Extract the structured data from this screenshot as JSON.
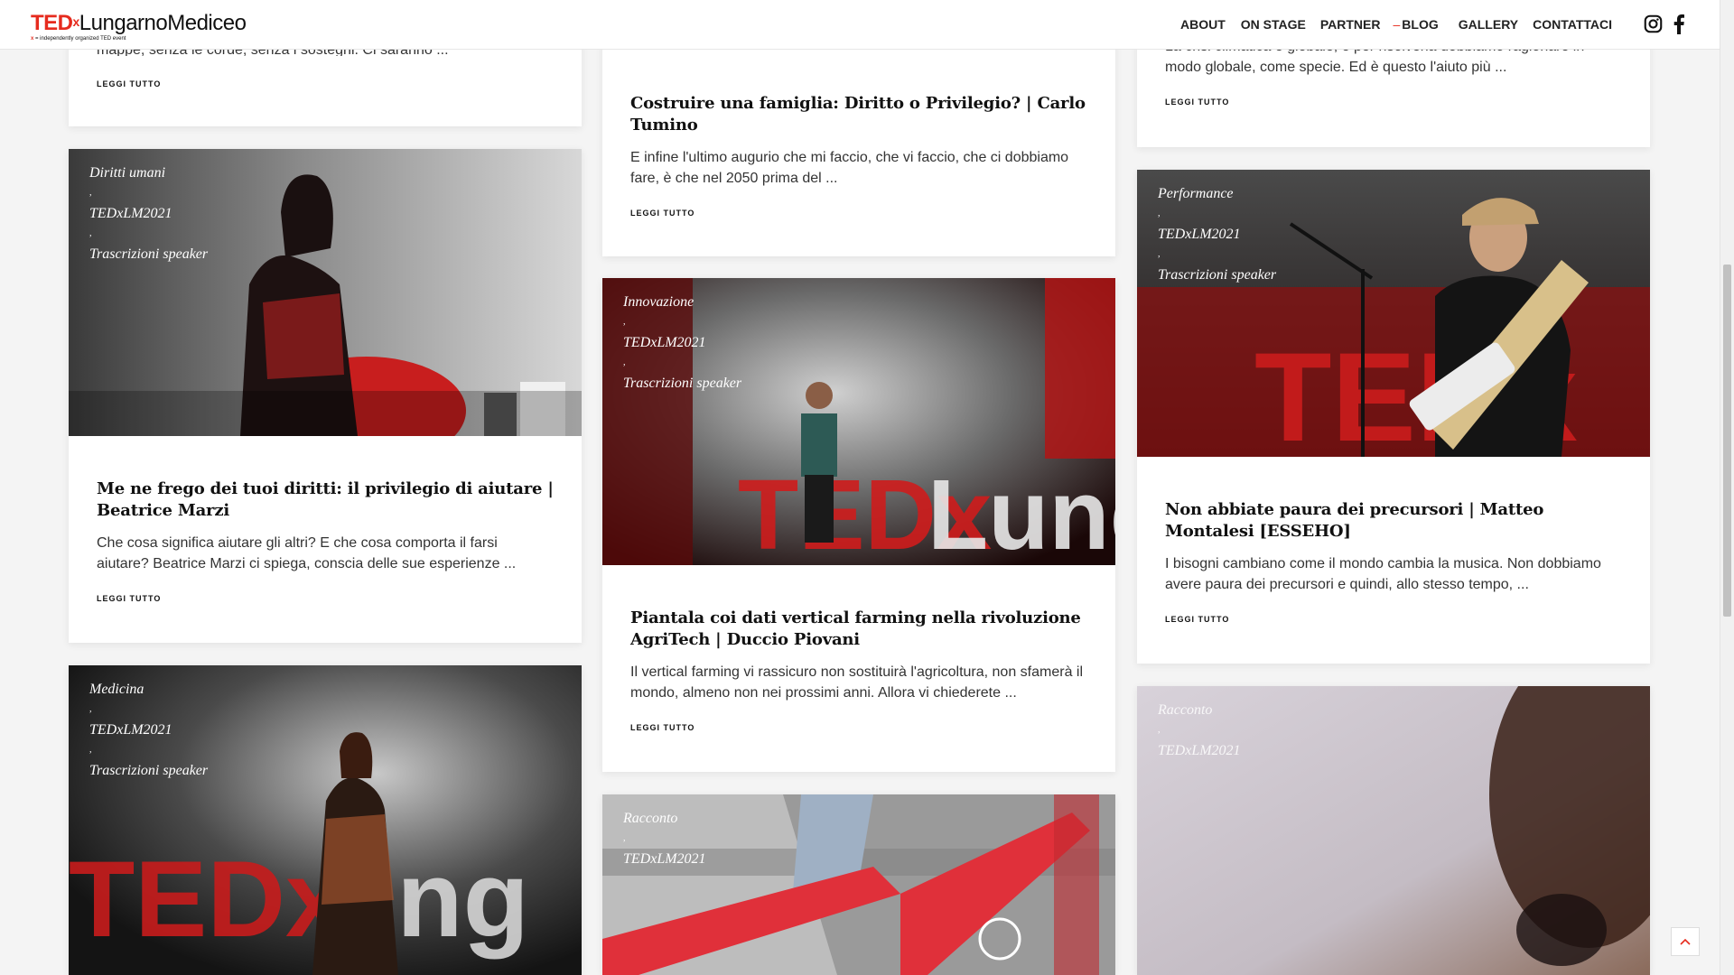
{
  "header": {
    "logo_ted": "TED",
    "logo_x": "x",
    "logo_name": "LungarnoMediceo",
    "logo_sub_x": "x",
    "logo_sub": " = independently organized TED event",
    "nav": [
      "ABOUT",
      "ON STAGE",
      "PARTNER",
      "BLOG",
      "GALLERY",
      "CONTATTACI"
    ],
    "active_nav_marker": "–"
  },
  "separator": ",",
  "read_more": "LEGGI TUTTO",
  "partial_cards": {
    "left_excerpt": "mappe, senza le corde, senza i sostegni. Ci saranno ...",
    "right_excerpt_line1": "La crisi climatica è globale, e per risolverla dobbiamo ragionare in",
    "right_excerpt_line2": "modo globale, come specie. Ed è questo l'aiuto più ..."
  },
  "cards": [
    {
      "categories": [
        "Diritti umani",
        "TEDxLM2021",
        "Trascrizioni speaker"
      ],
      "title": "Me ne frego dei tuoi diritti: il privilegio di aiutare | Beatrice Marzi",
      "excerpt": "Che cosa significa aiutare gli altri? E che cosa comporta il farsi aiutare? Beatrice Marzi ci spiega, conscia delle sue esperienze ..."
    },
    {
      "categories": [
        "Medicina",
        "TEDxLM2021",
        "Trascrizioni speaker"
      ]
    },
    {
      "title": "Costruire una famiglia: Diritto o Privilegio? | Carlo Tumino",
      "excerpt": "E infine l'ultimo augurio che mi faccio, che vi faccio, che ci dobbiamo fare, è che nel 2050 prima del ..."
    },
    {
      "categories": [
        "Innovazione",
        "TEDxLM2021",
        "Trascrizioni speaker"
      ],
      "title": "Piantala coi dati vertical farming nella rivoluzione AgriTech | Duccio Piovani",
      "excerpt": "Il vertical farming vi rassicuro non sostituirà l'agricoltura, non sfamerà il mondo, almeno non nei prossimi anni. Allora vi chiederete ..."
    },
    {
      "categories": [
        "Racconto",
        "TEDxLM2021"
      ]
    },
    {
      "categories": [
        "Performance",
        "TEDxLM2021",
        "Trascrizioni speaker"
      ],
      "title": "Non abbiate paura dei precursori | Matteo Montalesi [ESSEHO]",
      "excerpt": "I bisogni cambiano come il mondo cambia la musica. Non dobbiamo avere paura dei precursori e quindi, allo stesso tempo, ..."
    },
    {
      "categories": [
        "Racconto",
        "TEDxLM2021"
      ]
    }
  ],
  "colors": {
    "ted_red": "#e62b1e",
    "text": "#222222",
    "page_bg": "#f4f4f4"
  }
}
